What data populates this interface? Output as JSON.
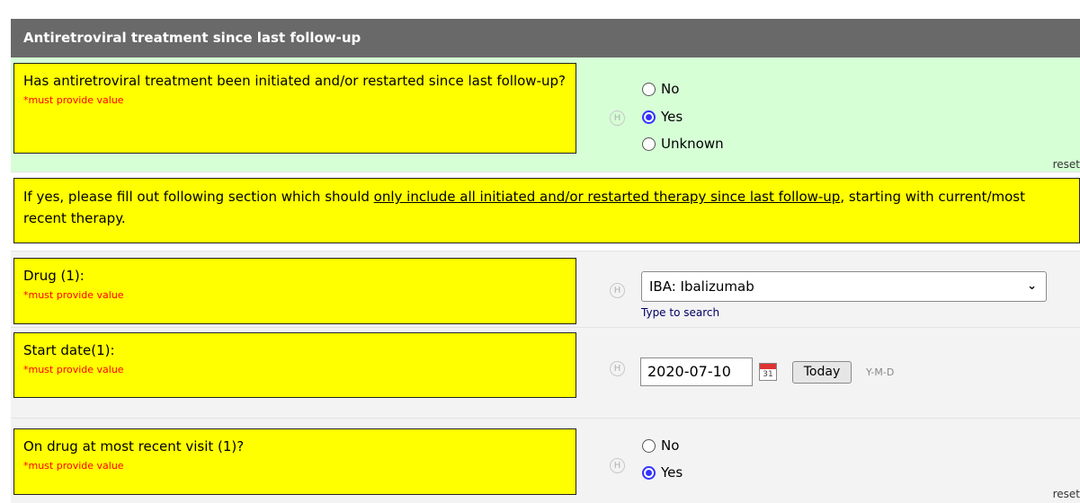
{
  "section": {
    "title": "Antiretroviral treatment since last follow-up"
  },
  "q1": {
    "label": "Has antiretroviral treatment been initiated and/or restarted since last follow-up?",
    "required": "*must provide value",
    "options": [
      "No",
      "Yes",
      "Unknown"
    ],
    "selected": "Yes",
    "reset": "reset"
  },
  "instruction": {
    "prefix": "If yes, please fill out following section which should ",
    "underlined": "only include all initiated and/or restarted therapy since last follow-up",
    "suffix": ", starting with current/most recent therapy."
  },
  "drug": {
    "label": "Drug (1):",
    "required": "*must provide value",
    "value": "IBA: Ibalizumab",
    "hint": "Type to search"
  },
  "start_date": {
    "label": "Start date(1):",
    "required": "*must provide value",
    "value": "2020-07-10",
    "calendar_day": "31",
    "today_label": "Today",
    "format": "Y-M-D"
  },
  "on_drug": {
    "label": "On drug at most recent visit (1)?",
    "required": "*must provide value",
    "options": [
      "No",
      "Yes"
    ],
    "selected": "Yes",
    "reset": "reset"
  },
  "help_icon_text": "H"
}
